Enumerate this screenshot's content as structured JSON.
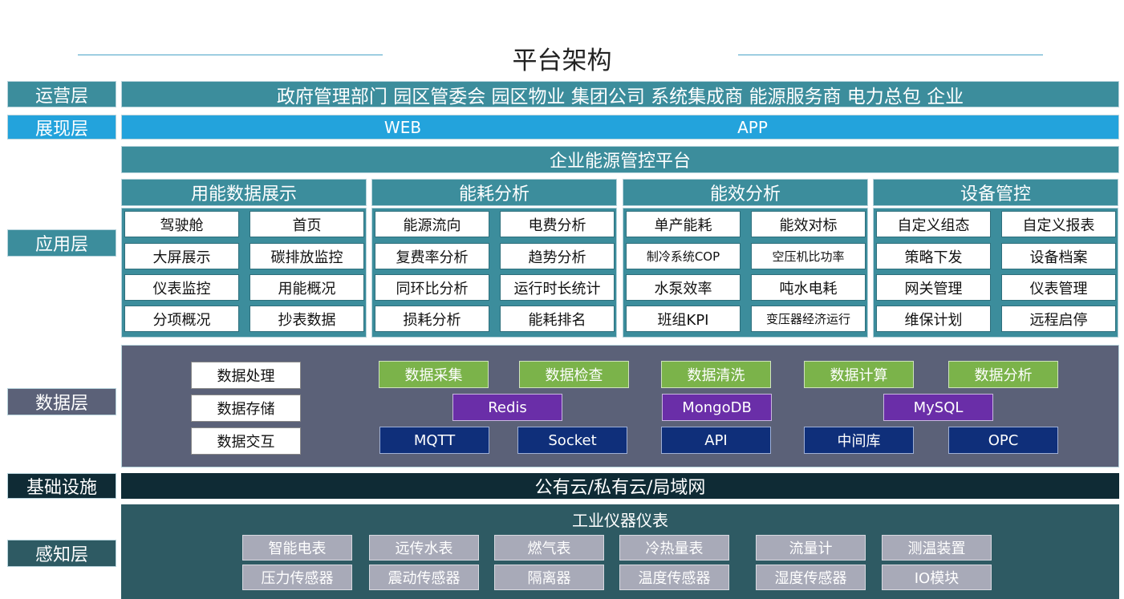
{
  "title": "平台架构",
  "layers": {
    "operation": "运营层",
    "presentation": "展现层",
    "application": "应用层",
    "data": "数据层",
    "infrastructure": "基础设施",
    "perception": "感知层"
  },
  "operation_items": "政府管理部门 园区管委会 园区物业 集团公司 系统集成商 能源服务商 电力总包 企业",
  "presentation_items": [
    "WEB",
    "APP"
  ],
  "platform": "企业能源管控平台",
  "app_groups": [
    {
      "title": "用能数据展示",
      "items": [
        "驾驶舱",
        "首页",
        "大屏展示",
        "碳排放监控",
        "仪表监控",
        "用能概况",
        "分项概况",
        "抄表数据"
      ]
    },
    {
      "title": "能耗分析",
      "items": [
        "能源流向",
        "电费分析",
        "复费率分析",
        "趋势分析",
        "同环比分析",
        "运行时长统计",
        "损耗分析",
        "能耗排名"
      ]
    },
    {
      "title": "能效分析",
      "items": [
        "单产能耗",
        "能效对标",
        "制冷系统COP",
        "空压机比功率",
        "水泵效率",
        "吨水电耗",
        "班组KPI",
        "变压器经济运行"
      ]
    },
    {
      "title": "设备管控",
      "items": [
        "自定义组态",
        "自定义报表",
        "策略下发",
        "设备档案",
        "网关管理",
        "仪表管理",
        "维保计划",
        "远程启停"
      ]
    }
  ],
  "data_left": [
    "数据处理",
    "数据存储",
    "数据交互"
  ],
  "data_process": [
    "数据采集",
    "数据检查",
    "数据清洗",
    "数据计算",
    "数据分析"
  ],
  "data_db": [
    "Redis",
    "MongoDB",
    "MySQL"
  ],
  "data_protocol": [
    "MQTT",
    "Socket",
    "API",
    "中间库",
    "OPC"
  ],
  "infrastructure_text": "公有云/私有云/局域网",
  "perception_title": "工业仪器仪表",
  "perception_items": [
    "智能电表",
    "远传水表",
    "燃气表",
    "冷热量表",
    "流量计",
    "测温装置",
    "压力传感器",
    "震动传感器",
    "隔离器",
    "温度传感器",
    "湿度传感器",
    "IO模块"
  ]
}
